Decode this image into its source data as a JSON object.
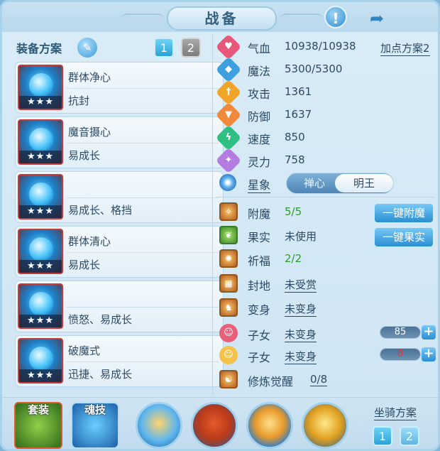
{
  "window": {
    "title": "战备"
  },
  "equip_plan": {
    "label": "装备方案",
    "plans": [
      "1",
      "2"
    ],
    "active_plan": "1",
    "items": [
      {
        "name": "群体净心",
        "tags": "抗封",
        "stars": "★★★"
      },
      {
        "name": "魔音摄心",
        "tags": "易成长",
        "stars": "★★★"
      },
      {
        "name": "",
        "tags": "易成长、格挡",
        "stars": "★★★"
      },
      {
        "name": "群体清心",
        "tags": "易成长",
        "stars": "★★★"
      },
      {
        "name": "",
        "tags": "愤怒、易成长",
        "stars": "★★★"
      },
      {
        "name": "破魔式",
        "tags": "迅捷、易成长",
        "stars": "★★★"
      }
    ]
  },
  "stats": [
    {
      "name": "气血",
      "value": "10938/10938",
      "icon": "heart-icon",
      "color": "#e8587a"
    },
    {
      "name": "魔法",
      "value": "5300/5300",
      "icon": "mana-icon",
      "color": "#3c9fe0"
    },
    {
      "name": "攻击",
      "value": "1361",
      "icon": "sword-icon",
      "color": "#f0a52a"
    },
    {
      "name": "防御",
      "value": "1637",
      "icon": "shield-icon",
      "color": "#f08a3a"
    },
    {
      "name": "速度",
      "value": "850",
      "icon": "lightning-icon",
      "color": "#2fbf82"
    },
    {
      "name": "灵力",
      "value": "758",
      "icon": "spirit-icon",
      "color": "#b47be0"
    }
  ],
  "add_point_plan": "加点方案2",
  "star_sign": {
    "label": "星象",
    "options": [
      "禅心",
      "明王"
    ],
    "selected": "明王"
  },
  "attributes": [
    {
      "name": "附魔",
      "value": "5/5",
      "style": "green"
    },
    {
      "name": "果实",
      "value": "未使用",
      "style": "plain"
    },
    {
      "name": "祈福",
      "value": "2/2",
      "style": "green"
    },
    {
      "name": "封地",
      "value": "未受赏",
      "style": "link"
    },
    {
      "name": "变身",
      "value": "未变身",
      "style": "link"
    },
    {
      "name": "子女",
      "value": "未变身",
      "style": "link"
    },
    {
      "name": "子女",
      "value": "未变身",
      "style": "link"
    },
    {
      "name": "修炼觉醒",
      "value": "0/8",
      "style": "link"
    }
  ],
  "buttons": {
    "enchant_all": "一键附魔",
    "fruit_all": "一键果实"
  },
  "child_points": [
    "85",
    "0"
  ],
  "bottom": {
    "set_label": "套装",
    "soul_label": "魂技",
    "mount_label": "坐骑方案",
    "mount_plans": [
      "1",
      "2"
    ]
  }
}
